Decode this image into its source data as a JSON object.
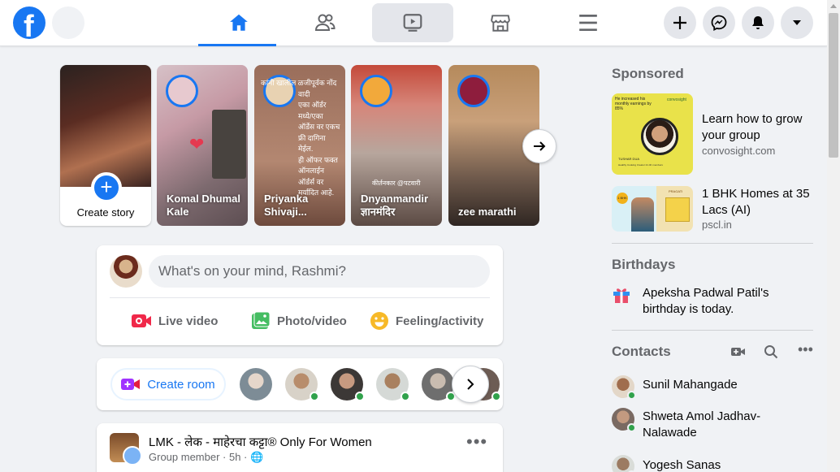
{
  "app": {
    "logo_letter": "f",
    "brand_color": "#1877f2"
  },
  "nav": {
    "tabs": [
      {
        "name": "home",
        "icon": "home-icon",
        "active": true
      },
      {
        "name": "friends",
        "icon": "friends-icon"
      },
      {
        "name": "watch",
        "icon": "watch-icon",
        "hovered": true
      },
      {
        "name": "marketplace",
        "icon": "marketplace-icon"
      },
      {
        "name": "menu",
        "icon": "menu-icon"
      }
    ],
    "right_buttons": [
      "plus-icon",
      "messenger-icon",
      "notifications-icon",
      "caret-down-icon"
    ]
  },
  "stories": {
    "create_label": "Create story",
    "items": [
      {
        "name": "Komal Dhumal Kale"
      },
      {
        "name": "Priyanka Shivaji..."
      },
      {
        "name": "Dnyanmandir ज्ञानमंदिर"
      },
      {
        "name": "zee marathi"
      }
    ],
    "story2_overlay_text": "कांनी खालील ळजीपूर्वक नोंद वादी\nएका ऑर्डर मध्ये/एका ऑर्डेस वर एकच फ्री दागिना मेईल.\nही ऑफर फक्त ऑनलाईन ऑर्डर्स वर मर्यादित आहे.\nफ्री मधील हवा असणारा एक दागिना मार्क करून पाठवावा.\nऑर्डर बुक होण्या आधीच फ्री मधे हवा असणारा दागिना",
    "story3_overlay_text": "कीर्तनकार @पटवारी"
  },
  "composer": {
    "placeholder": "What's on your mind, Rashmi?",
    "actions": [
      {
        "label": "Live video",
        "icon": "live-video-icon",
        "color": "#f02849"
      },
      {
        "label": "Photo/video",
        "icon": "photo-icon",
        "color": "#45bd62"
      },
      {
        "label": "Feeling/activity",
        "icon": "feeling-icon",
        "color": "#f7b928"
      }
    ]
  },
  "rooms": {
    "create_label": "Create room"
  },
  "post": {
    "title": "LMK - लेक - माहेरचा कट्टा® Only For Women",
    "subtitle": "Group member · 5h · 🌐"
  },
  "sponsored": {
    "title": "Sponsored",
    "items": [
      {
        "text": "Learn how to grow your group",
        "url": "convosight.com",
        "image_text": "He increased his monthly earnings by 85%",
        "image_brand": "convosight",
        "image_name": "TUSHAR DUA",
        "image_caption": "Healthy Cooking Creator 21.4K members"
      },
      {
        "text": "1 BHK Homes at 35 Lacs (AI)",
        "url": "pscl.in",
        "image_price": "1 BHK",
        "image_brand": "PRAGATI"
      }
    ]
  },
  "birthdays": {
    "title": "Birthdays",
    "text": "Apeksha Padwal Patil's birthday is today."
  },
  "contacts": {
    "title": "Contacts",
    "items": [
      {
        "name": "Sunil Mahangade"
      },
      {
        "name": "Shweta Amol Jadhav-Nalawade"
      },
      {
        "name": "Yogesh Sanas"
      }
    ]
  }
}
